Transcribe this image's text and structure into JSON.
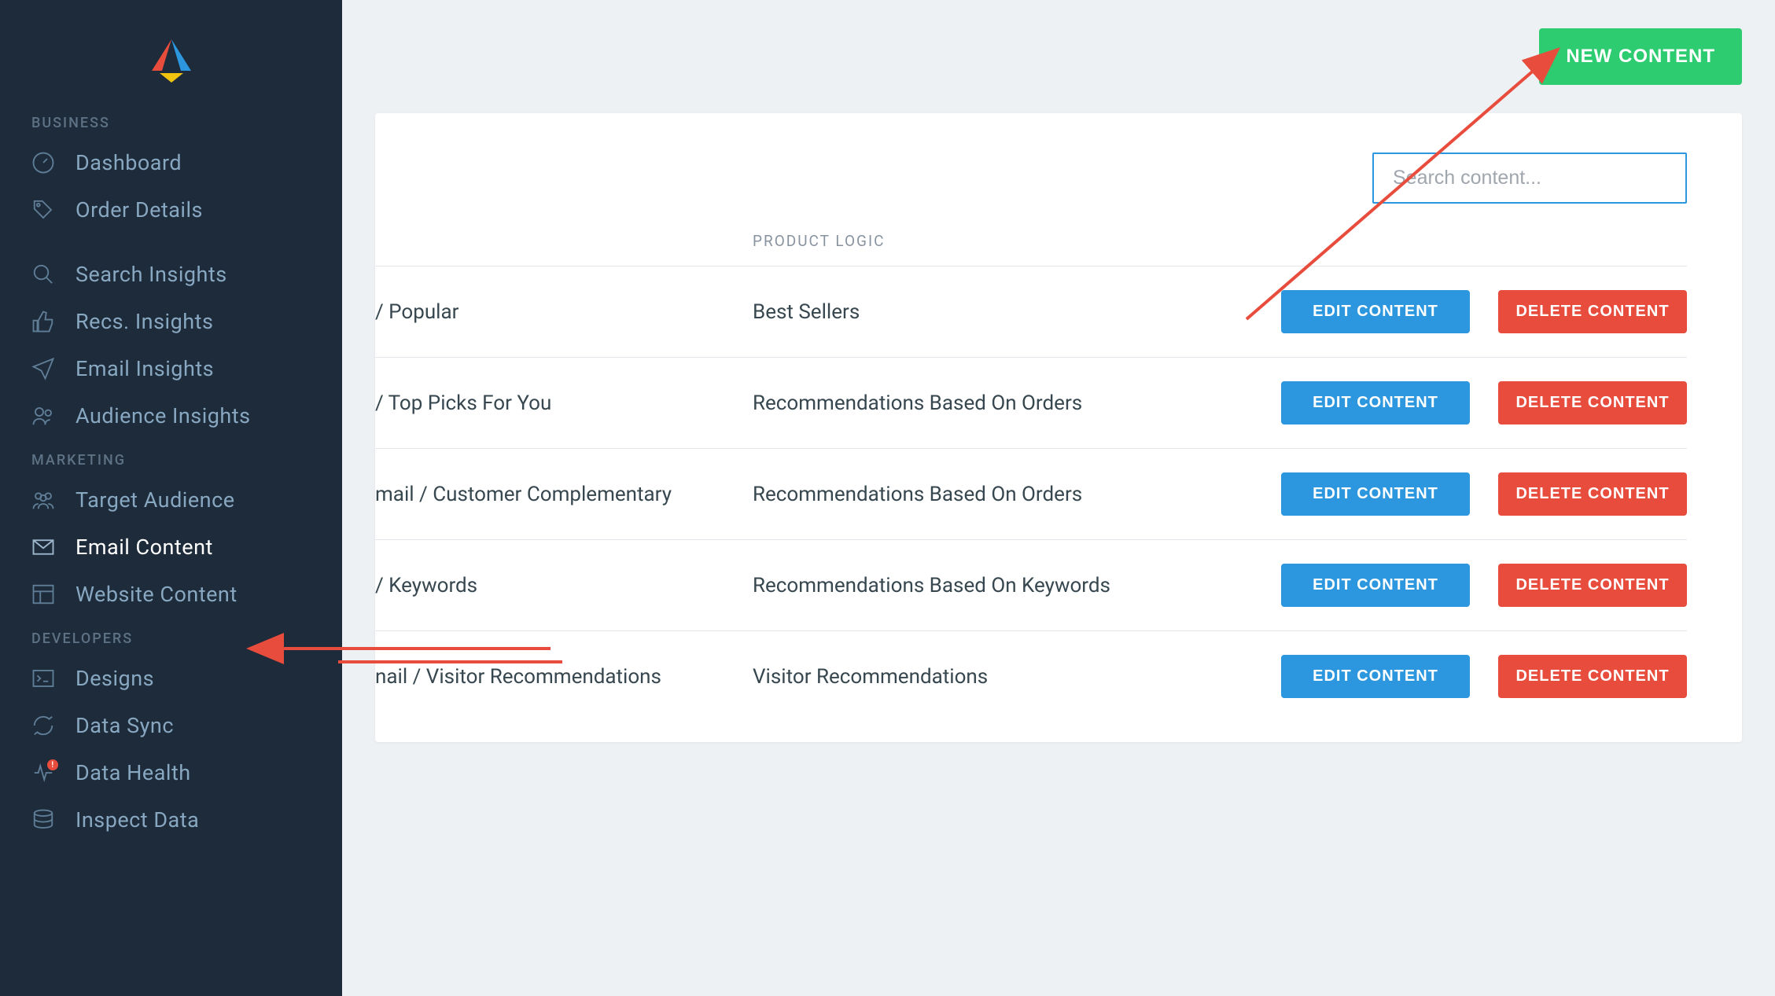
{
  "sidebar": {
    "sections": [
      {
        "title": "BUSINESS",
        "items": [
          {
            "label": "Dashboard",
            "icon": "gauge-icon"
          },
          {
            "label": "Order Details",
            "icon": "tag-icon"
          }
        ]
      },
      {
        "title": "",
        "items": [
          {
            "label": "Search Insights",
            "icon": "search-icon"
          },
          {
            "label": "Recs. Insights",
            "icon": "thumbs-up-icon"
          },
          {
            "label": "Email Insights",
            "icon": "paper-plane-icon"
          },
          {
            "label": "Audience Insights",
            "icon": "users-icon"
          }
        ]
      },
      {
        "title": "MARKETING",
        "items": [
          {
            "label": "Target Audience",
            "icon": "group-icon"
          },
          {
            "label": "Email Content",
            "icon": "envelope-icon",
            "active": true
          },
          {
            "label": "Website Content",
            "icon": "layout-icon"
          }
        ]
      },
      {
        "title": "DEVELOPERS",
        "items": [
          {
            "label": "Designs",
            "icon": "terminal-icon"
          },
          {
            "label": "Data Sync",
            "icon": "sync-icon"
          },
          {
            "label": "Data Health",
            "icon": "pulse-icon",
            "alert": "!"
          },
          {
            "label": "Inspect Data",
            "icon": "database-icon"
          }
        ]
      }
    ]
  },
  "topbar": {
    "new_content_label": "NEW CONTENT"
  },
  "search": {
    "placeholder": "Search content..."
  },
  "table": {
    "headers": {
      "logic": "PRODUCT LOGIC"
    },
    "edit_label": "EDIT CONTENT",
    "delete_label": "DELETE CONTENT",
    "rows": [
      {
        "name": "/ Popular",
        "logic": "Best Sellers"
      },
      {
        "name": "/ Top Picks For You",
        "logic": "Recommendations Based On Orders"
      },
      {
        "name": "mail / Customer Complementary",
        "logic": "Recommendations Based On Orders"
      },
      {
        "name": "/ Keywords",
        "logic": "Recommendations Based On Keywords"
      },
      {
        "name": "nail / Visitor Recommendations",
        "logic": "Visitor Recommendations"
      }
    ]
  }
}
